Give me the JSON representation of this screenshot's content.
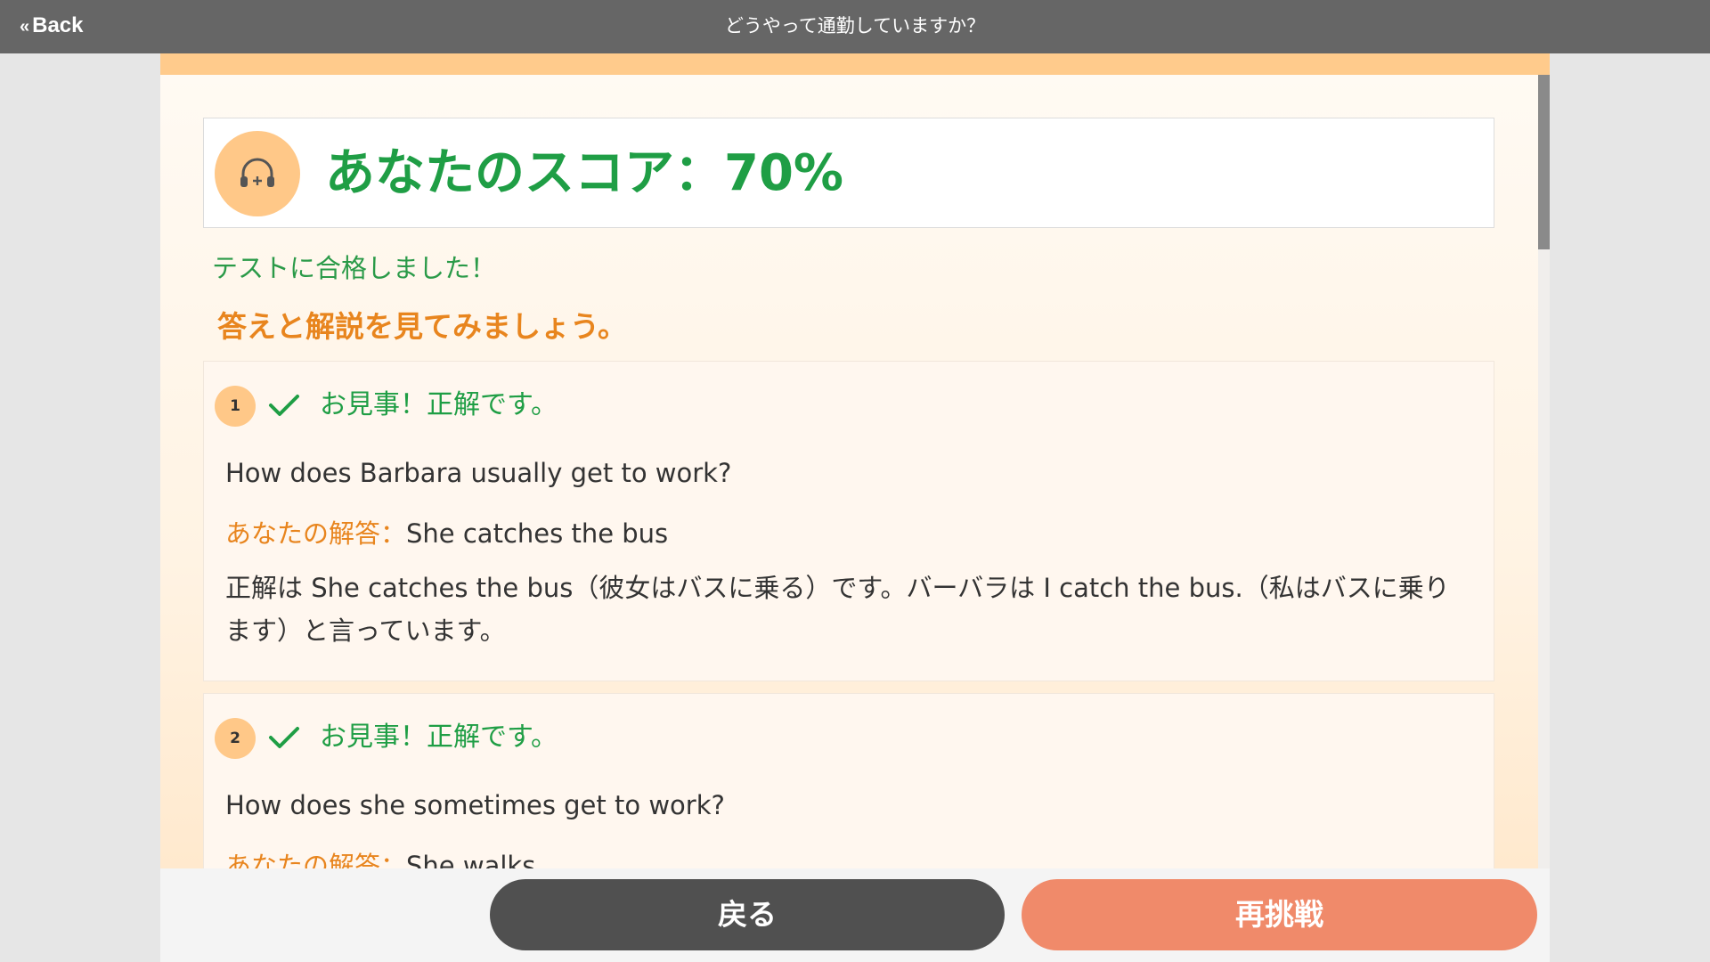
{
  "topbar": {
    "back_label": "Back",
    "title": "どうやって通勤していますか？"
  },
  "score": {
    "title": "あなたのスコア：70%",
    "value_percent": 70,
    "icon": "headphones-icon"
  },
  "messages": {
    "passed": "テストに合格しました！",
    "review": "答えと解説を見てみましょう。"
  },
  "questions": [
    {
      "number": "1",
      "status": "お見事！正解です。",
      "question": "How does Barbara usually get to work?",
      "answer_label": "あなたの解答：",
      "answer": "She catches the bus",
      "explanation": "正解は She catches the bus（彼女はバスに乗る）です。バーバラは I catch the bus.（私はバスに乗ります）と言っています。"
    },
    {
      "number": "2",
      "status": "お見事！正解です。",
      "question": "How does she sometimes get to work?",
      "answer_label": "あなたの解答：",
      "answer": "She walks"
    }
  ],
  "buttons": {
    "back": "戻る",
    "retry": "再挑戦"
  },
  "colors": {
    "topbar": "#666666",
    "accent_orange": "#ffc888",
    "success_green": "#1f9e45",
    "label_orange": "#e8851e",
    "retry_button": "#f08a6a",
    "back_button": "#505050"
  }
}
